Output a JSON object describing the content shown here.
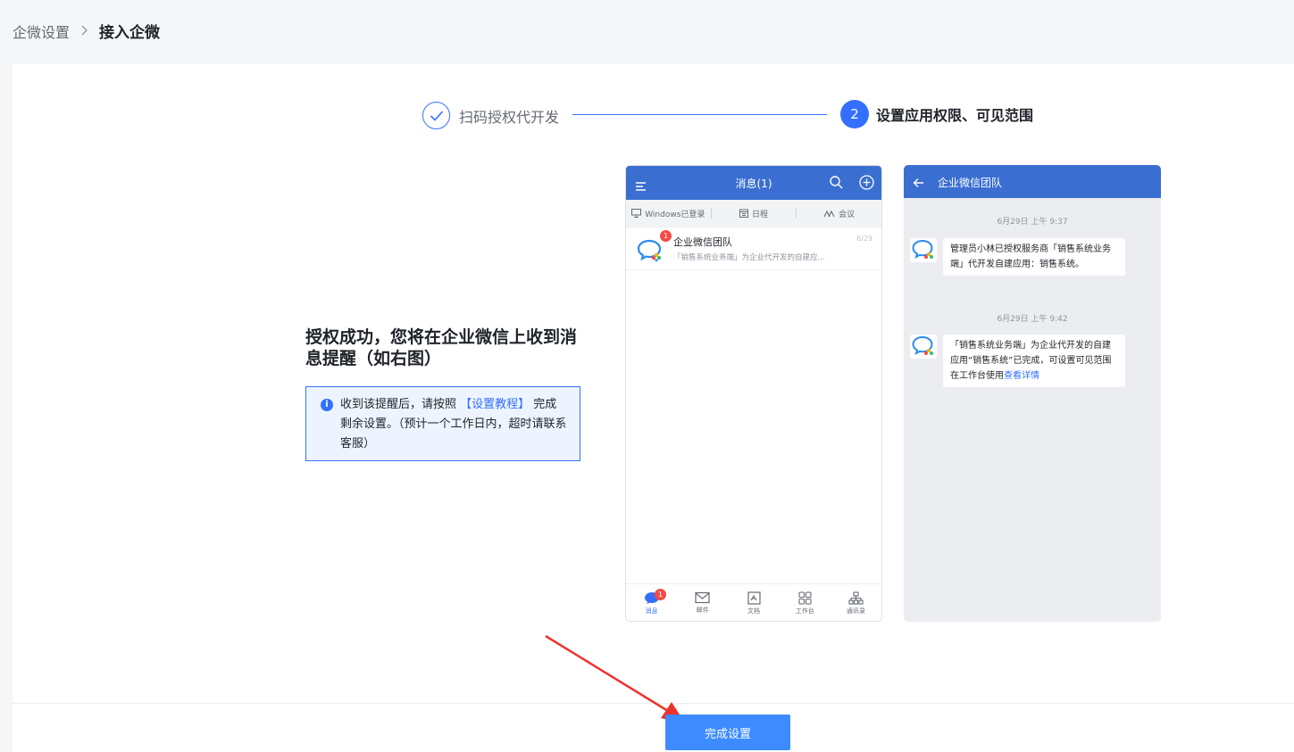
{
  "breadcrumb": {
    "parent": "企微设置",
    "separator": ">",
    "current": "接入企微"
  },
  "steps": [
    {
      "label": "扫码授权代开发",
      "status": "done"
    },
    {
      "number": "2",
      "label": "设置应用权限、可见范围",
      "status": "active"
    }
  ],
  "success": {
    "title": "授权成功，您将在企业微信上收到消息提醒（如右图）",
    "notice_pre": "收到该提醒后，请按照 ",
    "notice_link": "【设置教程】",
    "notice_post": " 完成剩余设置。（预计一个工作日内，超时请联系客服）"
  },
  "phone1": {
    "header_title": "消息(1)",
    "subbar": [
      "Windows已登录",
      "日程",
      "会议"
    ],
    "message": {
      "name": "企业微信团队",
      "preview": "「销售系统业务端」为企业代开发的自建应...",
      "date": "6/29",
      "badge": "1"
    },
    "tabs": [
      "消息",
      "邮件",
      "文档",
      "工作台",
      "通讯录"
    ],
    "tab_badge": "1"
  },
  "phone2": {
    "header_title": "企业微信团队",
    "messages": [
      {
        "time": "6月29日  上午 9:37",
        "text": "管理员小林已授权服务商「销售系统业务端」代开发自建应用：销售系统。"
      },
      {
        "time": "6月29日  上午 9:42",
        "text": "「销售系统业务端」为企业代开发的自建应用“销售系统”已完成，可设置可见范围在工作台使用",
        "link": "查看详情"
      }
    ]
  },
  "footer": {
    "button_label": "完成设置"
  },
  "colors": {
    "primary": "#3370ff",
    "header_blue": "#3a6fd1",
    "badge_red": "#f54a45",
    "arrow_red": "#f0322d"
  },
  "icons": [
    "chevron-right-icon",
    "check-icon",
    "info-icon",
    "menu-icon",
    "search-icon",
    "plus-circle-icon",
    "monitor-icon",
    "calendar-icon",
    "meeting-icon",
    "wecom-logo-icon",
    "chat-icon",
    "mail-icon",
    "doc-icon",
    "grid-icon",
    "contacts-icon",
    "back-arrow-icon"
  ]
}
